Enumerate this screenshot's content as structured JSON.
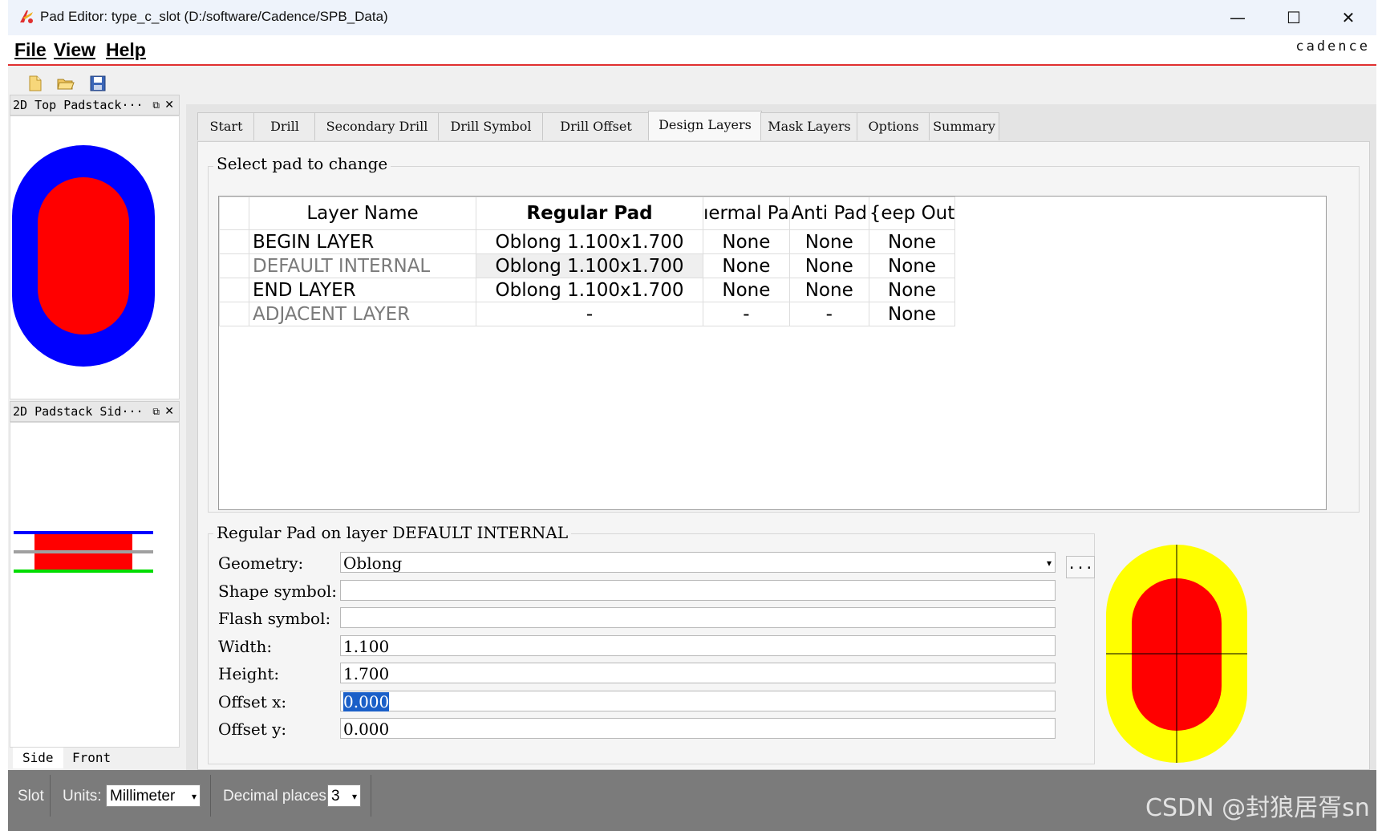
{
  "window": {
    "title": "Pad Editor: type_c_slot  (D:/software/Cadence/SPB_Data)",
    "controls": {
      "minimize": "—",
      "maximize": "☐",
      "close": "✕"
    }
  },
  "menu": {
    "items": [
      "File",
      "View",
      "Help"
    ],
    "logo": "cadence"
  },
  "toolbar": {
    "icons": [
      "new-file-icon",
      "open-folder-icon",
      "save-icon"
    ]
  },
  "left_dock": {
    "top_title": "2D Top Padstack···",
    "side_title": "2D Padstack Sid···",
    "float_glyph": "⧉",
    "close_glyph": "✕",
    "view_tabs": [
      "Side",
      "Front"
    ]
  },
  "tabs": [
    "Start",
    "Drill",
    "Secondary Drill",
    "Drill Symbol",
    "Drill Offset",
    "Design Layers",
    "Mask Layers",
    "Options",
    "Summary"
  ],
  "active_tab": "Design Layers",
  "pad_table": {
    "group_title": "Select pad to change",
    "headers": [
      "Layer Name",
      "Regular Pad",
      "ıermal Pa",
      "Anti Pad",
      "{eep Out"
    ],
    "rows": [
      [
        "BEGIN LAYER",
        "Oblong 1.100x1.700",
        "None",
        "None",
        "None"
      ],
      [
        "DEFAULT INTERNAL",
        "Oblong 1.100x1.700",
        "None",
        "None",
        "None"
      ],
      [
        "END LAYER",
        "Oblong 1.100x1.700",
        "None",
        "None",
        "None"
      ],
      [
        "ADJACENT LAYER",
        "-",
        "-",
        "-",
        "None"
      ]
    ]
  },
  "detail": {
    "title": "Regular Pad on layer DEFAULT INTERNAL",
    "labels": {
      "geometry": "Geometry:",
      "shape_symbol": "Shape symbol:",
      "flash_symbol": "Flash symbol:",
      "width": "Width:",
      "height": "Height:",
      "offset_x": "Offset x:",
      "offset_y": "Offset y:"
    },
    "values": {
      "geometry": "Oblong",
      "shape_symbol": "",
      "flash_symbol": "",
      "width": "1.100",
      "height": "1.700",
      "offset_x": "0.000",
      "offset_y": "0.000"
    },
    "browse_label": "...",
    "dropdown_arrow": "▾"
  },
  "status_bar": {
    "mode": "Slot",
    "units_label": "Units:",
    "units_value": "Millimeter",
    "decimal_label": "Decimal places:",
    "decimal_value": "3",
    "combo_arrow": "▾"
  },
  "watermark": "CSDN @封狼居胥sn",
  "colors": {
    "pad_blue": "#0000ff",
    "pad_red": "#ff0000",
    "pad_yellow": "#ffff00",
    "layer_green": "#00dd00",
    "layer_grey": "#a0a0a0",
    "menu_rule": "#e03030"
  }
}
